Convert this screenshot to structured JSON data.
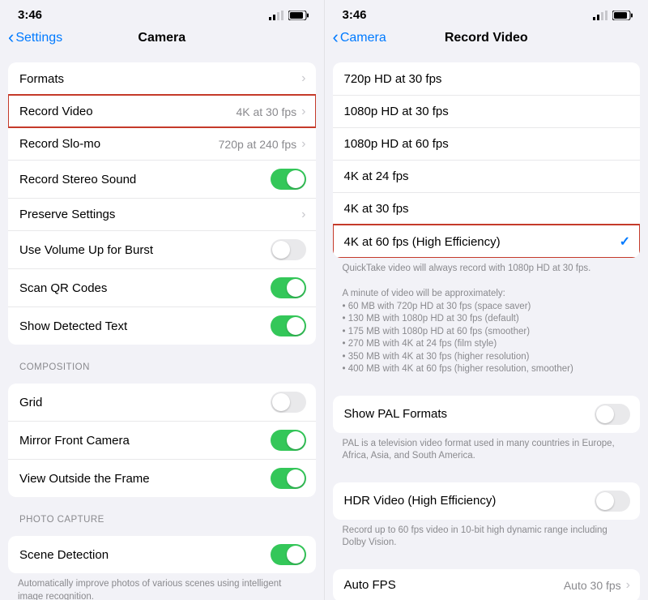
{
  "left": {
    "status": {
      "time": "3:46"
    },
    "nav": {
      "back_label": "Settings",
      "title": "Camera"
    },
    "group1": [
      {
        "label": "Formats",
        "chevron": true
      },
      {
        "label": "Record Video",
        "detail": "4K at 30 fps",
        "chevron": true,
        "highlight": true
      },
      {
        "label": "Record Slo-mo",
        "detail": "720p at 240 fps",
        "chevron": true
      },
      {
        "label": "Record Stereo Sound",
        "toggle": "on"
      },
      {
        "label": "Preserve Settings",
        "chevron": true
      },
      {
        "label": "Use Volume Up for Burst",
        "toggle": "off"
      },
      {
        "label": "Scan QR Codes",
        "toggle": "on"
      },
      {
        "label": "Show Detected Text",
        "toggle": "on"
      }
    ],
    "section_composition": "COMPOSITION",
    "group2": [
      {
        "label": "Grid",
        "toggle": "off"
      },
      {
        "label": "Mirror Front Camera",
        "toggle": "on"
      },
      {
        "label": "View Outside the Frame",
        "toggle": "on"
      }
    ],
    "section_photo": "PHOTO CAPTURE",
    "group3": [
      {
        "label": "Scene Detection",
        "toggle": "on"
      }
    ],
    "photo_footer": "Automatically improve photos of various scenes using intelligent image recognition."
  },
  "right": {
    "status": {
      "time": "3:46"
    },
    "nav": {
      "back_label": "Camera",
      "title": "Record Video"
    },
    "options": [
      {
        "label": "720p HD at 30 fps"
      },
      {
        "label": "1080p HD at 30 fps"
      },
      {
        "label": "1080p HD at 60 fps"
      },
      {
        "label": "4K at 24 fps"
      },
      {
        "label": "4K at 30 fps"
      },
      {
        "label": "4K at 60 fps (High Efficiency)",
        "checked": true,
        "highlight": true
      }
    ],
    "options_footer_lines": [
      "QuickTake video will always record with 1080p HD at 30 fps.",
      "",
      "A minute of video will be approximately:",
      "• 60 MB with 720p HD at 30 fps (space saver)",
      "• 130 MB with 1080p HD at 30 fps (default)",
      "• 175 MB with 1080p HD at 60 fps (smoother)",
      "• 270 MB with 4K at 24 fps (film style)",
      "• 350 MB with 4K at 30 fps (higher resolution)",
      "• 400 MB with 4K at 60 fps (higher resolution, smoother)"
    ],
    "pal": {
      "label": "Show PAL Formats",
      "toggle": "off"
    },
    "pal_footer": "PAL is a television video format used in many countries in Europe, Africa, Asia, and South America.",
    "hdr": {
      "label": "HDR Video (High Efficiency)",
      "toggle": "off"
    },
    "hdr_footer": "Record up to 60 fps video in 10-bit high dynamic range including Dolby Vision.",
    "autofps": {
      "label": "Auto FPS",
      "detail": "Auto 30 fps"
    }
  }
}
